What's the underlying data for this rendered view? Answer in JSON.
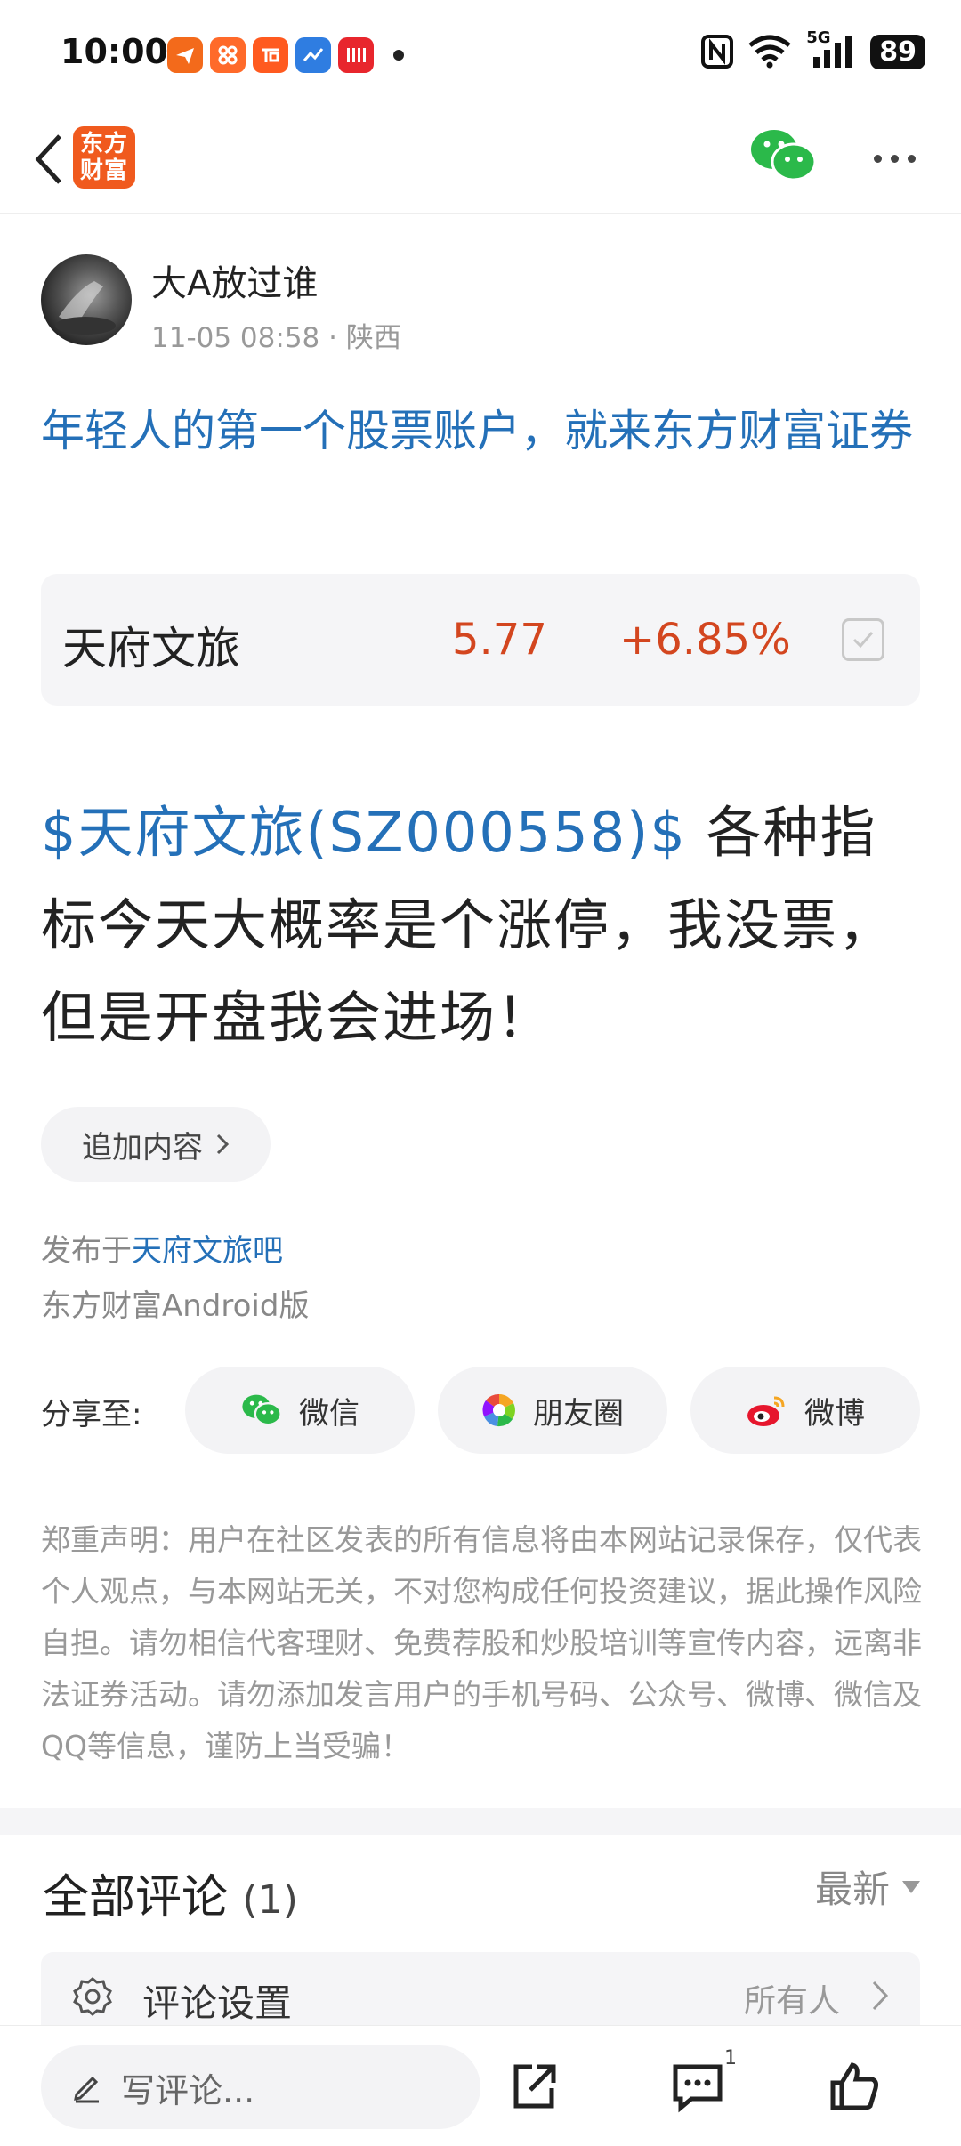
{
  "status_bar": {
    "time": "10:00",
    "battery": "89",
    "signal_label": "5G",
    "notification_icons": [
      "app-orange-plane-icon",
      "app-orange-grid-icon",
      "taobao-icon",
      "app-blue-chart-icon",
      "double11-icon"
    ]
  },
  "header": {
    "logo_line1": "东方",
    "logo_line2": "财富"
  },
  "author": {
    "name": "大A放过谁",
    "time": "11-05 08:58",
    "location": "· 陕西"
  },
  "ad_title": "年轻人的第一个股票账户，就来东方财富证券",
  "stock_card": {
    "name": "天府文旅",
    "price": "5.77",
    "change": "+6.85%"
  },
  "post": {
    "stock_tag": "$天府文旅(SZ000558)$",
    "text": "  各种指标今天大概率是个涨停，我没票，但是开盘我会进场！"
  },
  "append_label": "追加内容",
  "publish": {
    "prefix": "发布于",
    "forum": "天府文旅吧",
    "client": "东方财富Android版"
  },
  "share": {
    "label": "分享至:",
    "wechat": "微信",
    "moments": "朋友圈",
    "weibo": "微博"
  },
  "disclaimer": "郑重声明：用户在社区发表的所有信息将由本网站记录保存，仅代表个人观点，与本网站无关，不对您构成任何投资建议，据此操作风险自担。请勿相信代客理财、免费荐股和炒股培训等宣传内容，远离非法证券活动。请勿添加发言用户的手机号码、公众号、微博、微信及QQ等信息，谨防上当受骗！",
  "comments": {
    "title": "全部评论",
    "count": "(1)",
    "sort": "最新",
    "settings_label": "评论设置",
    "settings_value": "所有人"
  },
  "bottom_bar": {
    "placeholder": "写评论...",
    "comment_badge": "1"
  },
  "colors": {
    "brand": "#f05a1e",
    "link": "#2470b8",
    "rise": "#d3461f",
    "wechat": "#2bb94a"
  }
}
